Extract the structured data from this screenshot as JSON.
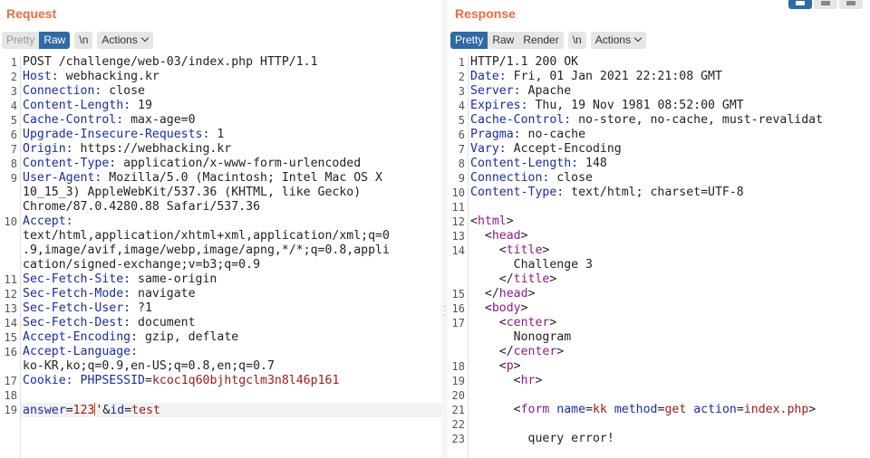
{
  "request": {
    "title": "Request",
    "buttons": {
      "pretty": "Pretty",
      "raw": "Raw",
      "newline": "\\n",
      "actions": "Actions"
    },
    "lines": [
      {
        "n": "1",
        "parts": [
          [
            "POST /challenge/web-03/index.php HTTP/1.1",
            ""
          ]
        ]
      },
      {
        "n": "2",
        "parts": [
          [
            "Host:",
            "hk"
          ],
          [
            " webhacking.kr",
            ""
          ]
        ]
      },
      {
        "n": "3",
        "parts": [
          [
            "Connection:",
            "hk"
          ],
          [
            " close",
            ""
          ]
        ]
      },
      {
        "n": "4",
        "parts": [
          [
            "Content-Length:",
            "hk"
          ],
          [
            " 19",
            ""
          ]
        ]
      },
      {
        "n": "5",
        "parts": [
          [
            "Cache-Control:",
            "hk"
          ],
          [
            " max-age=0",
            ""
          ]
        ]
      },
      {
        "n": "6",
        "parts": [
          [
            "Upgrade-Insecure-Requests:",
            "hk"
          ],
          [
            " 1",
            ""
          ]
        ]
      },
      {
        "n": "7",
        "parts": [
          [
            "Origin:",
            "hk"
          ],
          [
            " https://webhacking.kr",
            ""
          ]
        ]
      },
      {
        "n": "8",
        "parts": [
          [
            "Content-Type:",
            "hk"
          ],
          [
            " application/x-www-form-urlencoded",
            ""
          ]
        ]
      },
      {
        "n": "9",
        "parts": [
          [
            "User-Agent:",
            "hk"
          ],
          [
            " Mozilla/5.0 (Macintosh; Intel Mac OS X",
            ""
          ]
        ]
      },
      {
        "n": "",
        "parts": [
          [
            "10_15_3) AppleWebKit/537.36 (KHTML, like Gecko)",
            ""
          ]
        ]
      },
      {
        "n": "",
        "parts": [
          [
            "Chrome/87.0.4280.88 Safari/537.36",
            ""
          ]
        ]
      },
      {
        "n": "10",
        "parts": [
          [
            "Accept:",
            "hk"
          ]
        ]
      },
      {
        "n": "",
        "parts": [
          [
            "text/html,application/xhtml+xml,application/xml;q=0",
            ""
          ]
        ]
      },
      {
        "n": "",
        "parts": [
          [
            ".9,image/avif,image/webp,image/apng,*/*;q=0.8,appli",
            ""
          ]
        ]
      },
      {
        "n": "",
        "parts": [
          [
            "cation/signed-exchange;v=b3;q=0.9",
            ""
          ]
        ]
      },
      {
        "n": "11",
        "parts": [
          [
            "Sec-Fetch-Site:",
            "hk"
          ],
          [
            " same-origin",
            ""
          ]
        ]
      },
      {
        "n": "12",
        "parts": [
          [
            "Sec-Fetch-Mode:",
            "hk"
          ],
          [
            " navigate",
            ""
          ]
        ]
      },
      {
        "n": "13",
        "parts": [
          [
            "Sec-Fetch-User:",
            "hk"
          ],
          [
            " ?1",
            ""
          ]
        ]
      },
      {
        "n": "14",
        "parts": [
          [
            "Sec-Fetch-Dest:",
            "hk"
          ],
          [
            " document",
            ""
          ]
        ]
      },
      {
        "n": "15",
        "parts": [
          [
            "Accept-Encoding:",
            "hk"
          ],
          [
            " gzip, deflate",
            ""
          ]
        ]
      },
      {
        "n": "16",
        "parts": [
          [
            "Accept-Language:",
            "hk"
          ]
        ]
      },
      {
        "n": "",
        "parts": [
          [
            "ko-KR,ko;q=0.9,en-US;q=0.8,en;q=0.7",
            ""
          ]
        ]
      },
      {
        "n": "17",
        "parts": [
          [
            "Cookie:",
            "hk"
          ],
          [
            " ",
            ""
          ],
          [
            "PHPSESSID",
            "hk"
          ],
          [
            "=",
            ""
          ],
          [
            "kcoc1q60bjhtgclm3n8l46p161",
            "cv"
          ]
        ]
      },
      {
        "n": "18",
        "parts": []
      },
      {
        "n": "19",
        "parts": [
          [
            "answer",
            "hk"
          ],
          [
            "=",
            ""
          ],
          [
            "123",
            "cv"
          ],
          [
            "|caret|",
            ""
          ],
          [
            "'&",
            ""
          ],
          [
            "id",
            "hk"
          ],
          [
            "=",
            ""
          ],
          [
            "test",
            "cv"
          ]
        ],
        "current": true
      }
    ]
  },
  "response": {
    "title": "Response",
    "buttons": {
      "pretty": "Pretty",
      "raw": "Raw",
      "render": "Render",
      "newline": "\\n",
      "actions": "Actions"
    },
    "lines": [
      {
        "n": "1",
        "parts": [
          [
            "HTTP/1.1 200 OK",
            ""
          ]
        ]
      },
      {
        "n": "2",
        "parts": [
          [
            "Date:",
            "hk"
          ],
          [
            " Fri, 01 Jan 2021 22:21:08 GMT",
            ""
          ]
        ]
      },
      {
        "n": "3",
        "parts": [
          [
            "Server:",
            "hk"
          ],
          [
            " Apache",
            ""
          ]
        ]
      },
      {
        "n": "4",
        "parts": [
          [
            "Expires:",
            "hk"
          ],
          [
            " Thu, 19 Nov 1981 08:52:00 GMT",
            ""
          ]
        ]
      },
      {
        "n": "5",
        "parts": [
          [
            "Cache-Control:",
            "hk"
          ],
          [
            " no-store, no-cache, must-revalidat",
            ""
          ]
        ]
      },
      {
        "n": "6",
        "parts": [
          [
            "Pragma:",
            "hk"
          ],
          [
            " no-cache",
            ""
          ]
        ]
      },
      {
        "n": "7",
        "parts": [
          [
            "Vary:",
            "hk"
          ],
          [
            " Accept-Encoding",
            ""
          ]
        ]
      },
      {
        "n": "8",
        "parts": [
          [
            "Content-Length:",
            "hk"
          ],
          [
            " 148",
            ""
          ]
        ]
      },
      {
        "n": "9",
        "parts": [
          [
            "Connection:",
            "hk"
          ],
          [
            " close",
            ""
          ]
        ]
      },
      {
        "n": "10",
        "parts": [
          [
            "Content-Type:",
            "hk"
          ],
          [
            " text/html; charset=UTF-8",
            ""
          ]
        ]
      },
      {
        "n": "11",
        "parts": []
      },
      {
        "n": "12",
        "parts": [
          [
            "<",
            ""
          ],
          [
            "html",
            "tg"
          ],
          [
            ">",
            ""
          ]
        ]
      },
      {
        "n": "13",
        "parts": [
          [
            "  <",
            ""
          ],
          [
            "head",
            "tg"
          ],
          [
            ">",
            ""
          ]
        ]
      },
      {
        "n": "14",
        "parts": [
          [
            "    <",
            ""
          ],
          [
            "title",
            "tg"
          ],
          [
            ">",
            ""
          ]
        ]
      },
      {
        "n": "",
        "parts": [
          [
            "      Challenge 3",
            ""
          ]
        ]
      },
      {
        "n": "",
        "parts": [
          [
            "    </",
            ""
          ],
          [
            "title",
            "tg"
          ],
          [
            ">",
            ""
          ]
        ]
      },
      {
        "n": "15",
        "parts": [
          [
            "  </",
            ""
          ],
          [
            "head",
            "tg"
          ],
          [
            ">",
            ""
          ]
        ]
      },
      {
        "n": "16",
        "parts": [
          [
            "  <",
            ""
          ],
          [
            "body",
            "tg"
          ],
          [
            ">",
            ""
          ]
        ]
      },
      {
        "n": "17",
        "parts": [
          [
            "    <",
            ""
          ],
          [
            "center",
            "tg"
          ],
          [
            ">",
            ""
          ]
        ]
      },
      {
        "n": "",
        "parts": [
          [
            "      Nonogram",
            ""
          ]
        ]
      },
      {
        "n": "",
        "parts": [
          [
            "    </",
            ""
          ],
          [
            "center",
            "tg"
          ],
          [
            ">",
            ""
          ]
        ]
      },
      {
        "n": "18",
        "parts": [
          [
            "    <",
            ""
          ],
          [
            "p",
            "tg"
          ],
          [
            ">",
            ""
          ]
        ]
      },
      {
        "n": "19",
        "parts": [
          [
            "      <",
            ""
          ],
          [
            "hr",
            "tg"
          ],
          [
            ">",
            ""
          ]
        ]
      },
      {
        "n": "20",
        "parts": []
      },
      {
        "n": "21",
        "parts": [
          [
            "      <",
            ""
          ],
          [
            "form",
            "tg"
          ],
          [
            " ",
            ""
          ],
          [
            "name",
            "hk"
          ],
          [
            "=",
            ""
          ],
          [
            "kk",
            "av"
          ],
          [
            " ",
            ""
          ],
          [
            "method",
            "hk"
          ],
          [
            "=",
            ""
          ],
          [
            "get",
            "av"
          ],
          [
            " ",
            ""
          ],
          [
            "action",
            "hk"
          ],
          [
            "=",
            ""
          ],
          [
            "index.php",
            "av"
          ],
          [
            ">",
            ""
          ]
        ]
      },
      {
        "n": "22",
        "parts": []
      },
      {
        "n": "23",
        "parts": [
          [
            "        query error!",
            ""
          ]
        ]
      }
    ]
  }
}
